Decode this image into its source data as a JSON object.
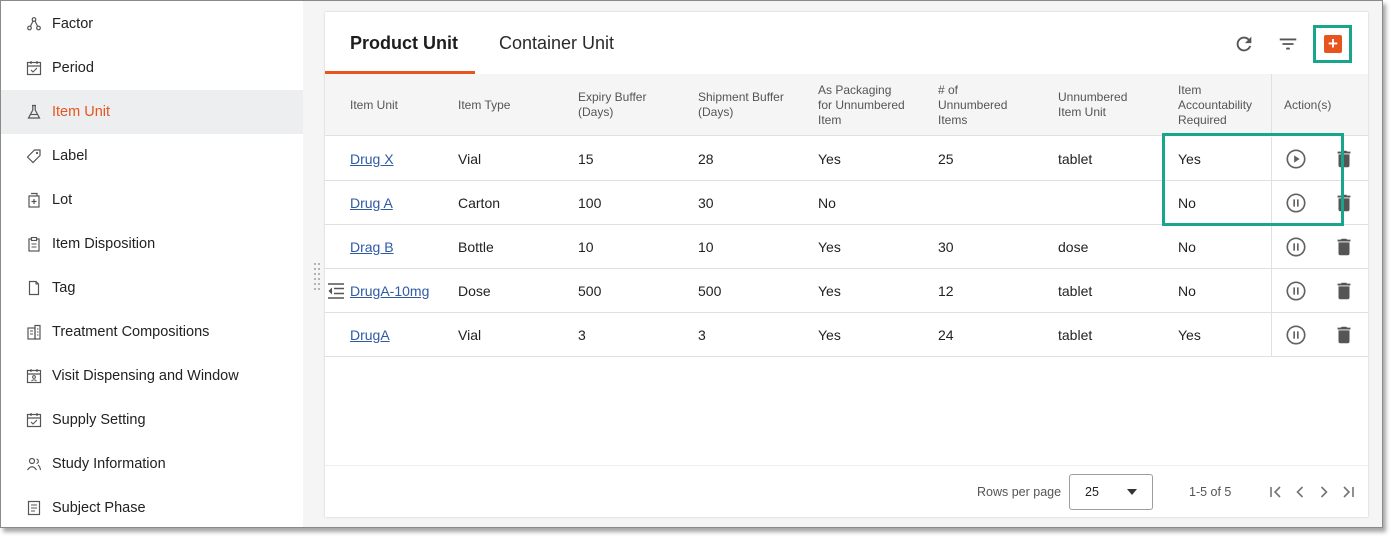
{
  "sidebar": {
    "items": [
      {
        "label": "Factor",
        "icon": "factor-icon",
        "active": false
      },
      {
        "label": "Period",
        "icon": "calendar-icon",
        "active": false
      },
      {
        "label": "Item Unit",
        "icon": "flask-icon",
        "active": true
      },
      {
        "label": "Label",
        "icon": "label-tag-icon",
        "active": false
      },
      {
        "label": "Lot",
        "icon": "lot-box-icon",
        "active": false
      },
      {
        "label": "Item Disposition",
        "icon": "clipboard-icon",
        "active": false
      },
      {
        "label": "Tag",
        "icon": "tag-icon",
        "active": false
      },
      {
        "label": "Treatment Compositions",
        "icon": "building-icon",
        "active": false
      },
      {
        "label": "Visit Dispensing and Window",
        "icon": "calendar-user-icon",
        "active": false
      },
      {
        "label": "Supply Setting",
        "icon": "calendar-check-icon",
        "active": false
      },
      {
        "label": "Study Information",
        "icon": "people-icon",
        "active": false
      },
      {
        "label": "Subject Phase",
        "icon": "document-list-icon",
        "active": false
      }
    ]
  },
  "tabs": [
    {
      "label": "Product Unit",
      "active": true
    },
    {
      "label": "Container Unit",
      "active": false
    }
  ],
  "toolbar": {
    "refresh_icon": "refresh-icon",
    "filter_icon": "filter-icon",
    "add_icon": "+"
  },
  "table": {
    "headers": {
      "item_unit": "Item Unit",
      "item_type": "Item Type",
      "expiry_buffer": "Expiry Buffer (Days)",
      "shipment_buffer": "Shipment Buffer (Days)",
      "as_packaging": "As Packaging for Unnumbered Item",
      "num_unnumbered": "# of Unnumbered Items",
      "unnumbered_unit": "Unnumbered Item Unit",
      "accountability": "Item Accountability Required",
      "actions": "Action(s)"
    },
    "rows": [
      {
        "item_unit": "Drug X",
        "item_type": "Vial",
        "expiry": "15",
        "shipment": "28",
        "packaging": "Yes",
        "count": "25",
        "unit": "tablet",
        "accountability": "Yes",
        "status_action": "play-circle-icon",
        "expand": false
      },
      {
        "item_unit": "Drug A",
        "item_type": "Carton",
        "expiry": "100",
        "shipment": "30",
        "packaging": "No",
        "count": "",
        "unit": "",
        "accountability": "No",
        "status_action": "pause-circle-icon",
        "expand": false
      },
      {
        "item_unit": "Drag B",
        "item_type": "Bottle",
        "expiry": "10",
        "shipment": "10",
        "packaging": "Yes",
        "count": "30",
        "unit": "dose",
        "accountability": "No",
        "status_action": "pause-circle-icon",
        "expand": false
      },
      {
        "item_unit": "DrugA-10mg",
        "item_type": "Dose",
        "expiry": "500",
        "shipment": "500",
        "packaging": "Yes",
        "count": "12",
        "unit": "tablet",
        "accountability": "No",
        "status_action": "pause-circle-icon",
        "expand": true
      },
      {
        "item_unit": "DrugA",
        "item_type": "Vial",
        "expiry": "3",
        "shipment": "3",
        "packaging": "Yes",
        "count": "24",
        "unit": "tablet",
        "accountability": "Yes",
        "status_action": "pause-circle-icon",
        "expand": false
      }
    ]
  },
  "pagination": {
    "rows_per_page_label": "Rows per page",
    "rows_per_page_value": "25",
    "range": "1-5 of 5"
  },
  "colors": {
    "accent": "#e8541e",
    "link": "#2f5aa6",
    "highlight": "#19a589"
  }
}
